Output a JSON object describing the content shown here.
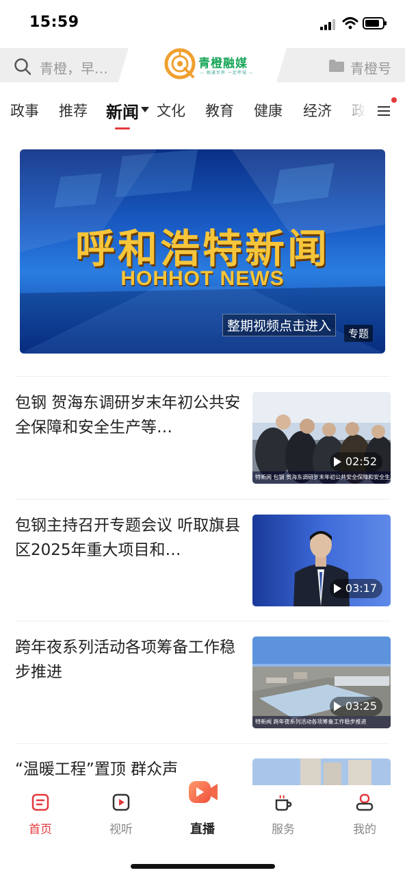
{
  "status": {
    "time": "15:59"
  },
  "header": {
    "search_placeholder": "青橙，早…",
    "logo_text": "青橙融媒",
    "logo_sub": "— 融通世界 一定呼城 —",
    "account_label": "青橙号"
  },
  "tabs": [
    {
      "label": "政事"
    },
    {
      "label": "推荐"
    },
    {
      "label": "新闻",
      "active": true
    },
    {
      "label": "文化"
    },
    {
      "label": "教育"
    },
    {
      "label": "健康"
    },
    {
      "label": "经济"
    },
    {
      "label": "政"
    }
  ],
  "banner": {
    "title": "呼和浩特新闻",
    "subtitle": "HOHHOT NEWS",
    "cta": "整期视频点击进入",
    "tag": "专题"
  },
  "news": [
    {
      "title": "包钢 贺海东调研岁末年初公共安全保障和安全生产等…",
      "duration": "02:52",
      "caption": "特新闻  包钢 贺海东调研岁末年初公共安全保障和安全生产等工作"
    },
    {
      "title": "包钢主持召开专题会议 听取旗县区2025年重大项目和…",
      "duration": "03:17"
    },
    {
      "title": "跨年夜系列活动各项筹备工作稳步推进",
      "duration": "03:25",
      "caption": "特新闻  跨年夜系列活动各项筹备工作稳步推进"
    },
    {
      "title": "“温暖工程”置顶 群众声"
    }
  ],
  "bottom_nav": [
    {
      "label": "首页",
      "icon": "home-icon",
      "active": true
    },
    {
      "label": "视听",
      "icon": "video-icon"
    },
    {
      "label": "直播",
      "icon": "live-icon"
    },
    {
      "label": "服务",
      "icon": "cup-icon"
    },
    {
      "label": "我的",
      "icon": "user-icon"
    }
  ],
  "colors": {
    "accent": "#e4393c",
    "brand": "#1aa75a",
    "logo_orange": "#f0a030"
  }
}
